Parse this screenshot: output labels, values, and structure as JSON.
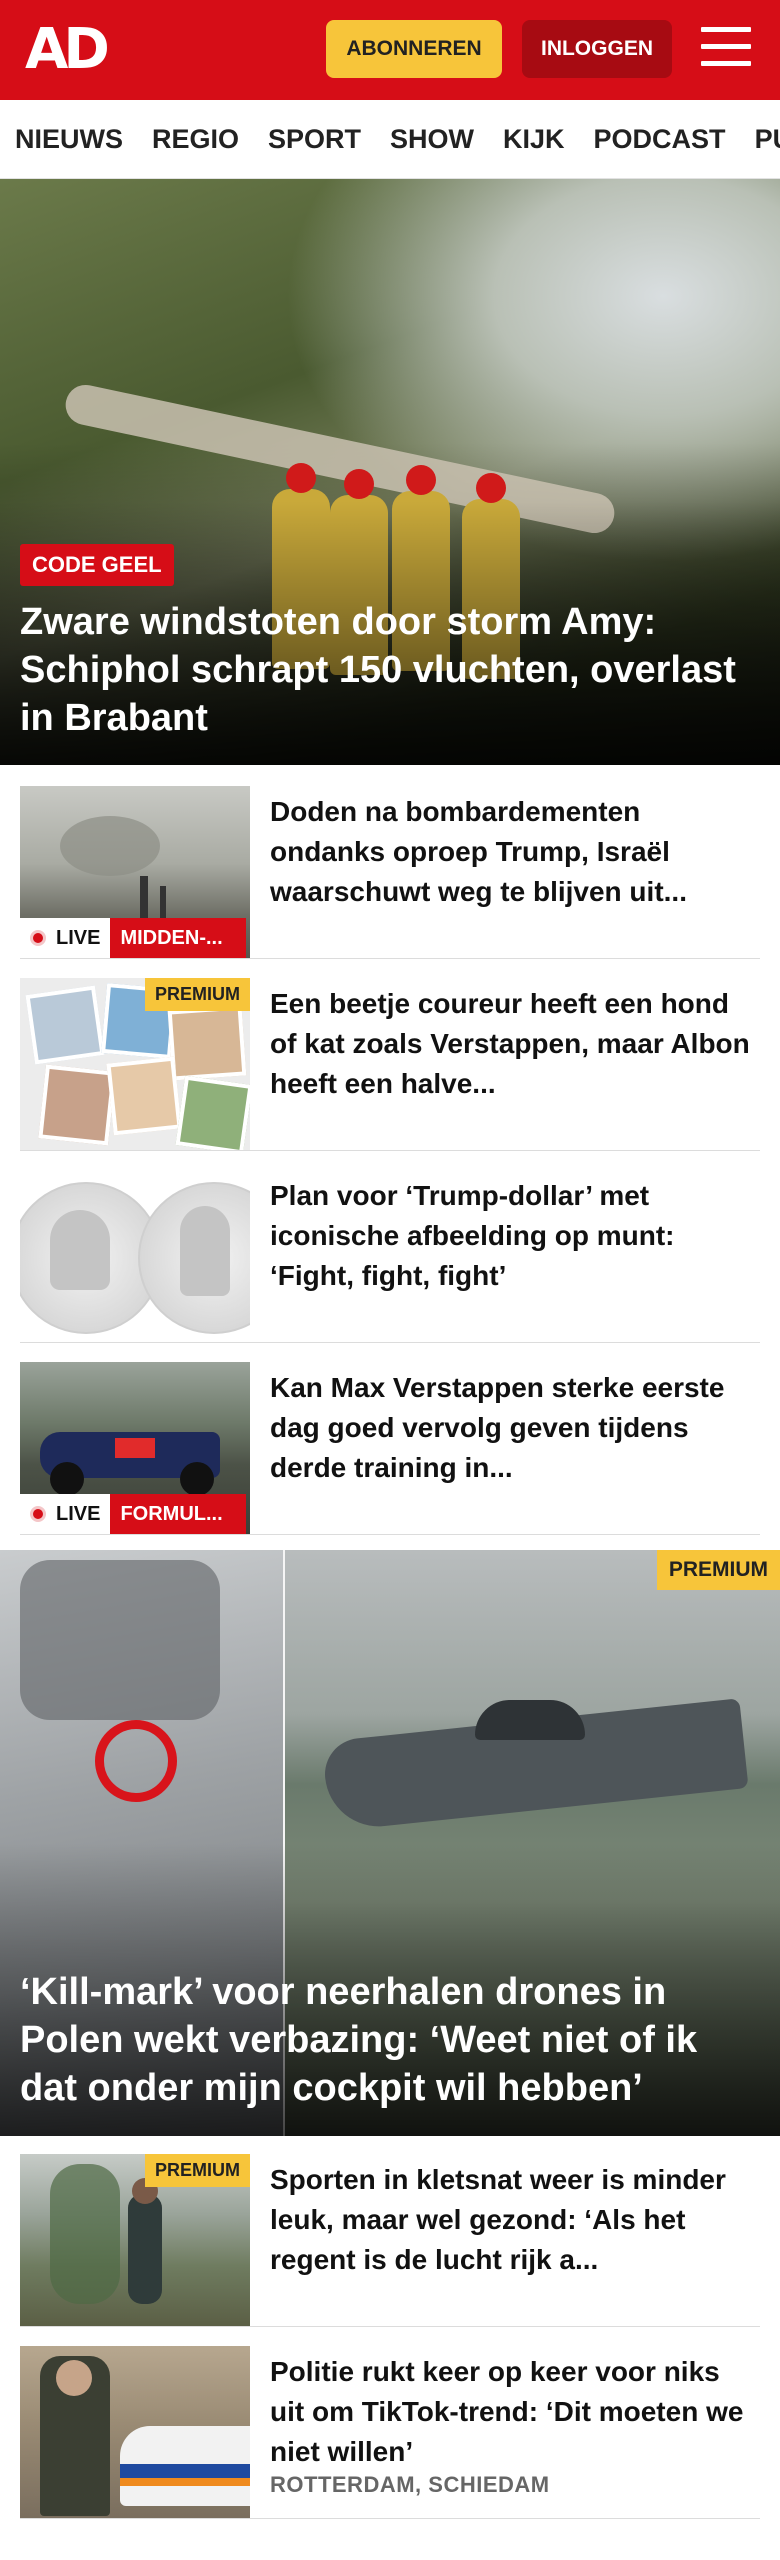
{
  "header": {
    "logo": "AD",
    "subscribe_label": "ABONNEREN",
    "login_label": "INLOGGEN",
    "menu_icon": "hamburger-menu-icon",
    "brand_color": "#d60d17",
    "subscribe_color": "#f7c53a"
  },
  "nav": {
    "items": [
      "NIEUWS",
      "REGIO",
      "SPORT",
      "SHOW",
      "KIJK",
      "PODCAST",
      "PUZZ"
    ]
  },
  "hero": {
    "tag": "CODE GEEL",
    "title": "Zware windstoten door storm Amy: Schiphol schrapt 150 vluchten, overlast in Brabant"
  },
  "articles": [
    {
      "title": "Doden na bombardementen ondanks oproep Trump, Israël waarschuwt weg te blijven uit...",
      "live_label": "LIVE",
      "live_category": "MIDDEN-..."
    },
    {
      "title": "Een beetje coureur heeft een hond of kat zoals Verstappen, maar Albon heeft een halve...",
      "badge": "PREMIUM"
    },
    {
      "title": "Plan voor ‘Trump-dollar’ met iconische afbeelding op munt: ‘Fight, fight, fight’"
    },
    {
      "title": "Kan Max Verstappen sterke eerste dag goed vervolg geven tijdens derde training in...",
      "live_label": "LIVE",
      "live_category": "FORMUL..."
    }
  ],
  "hero2": {
    "badge": "PREMIUM",
    "title": "‘Kill-mark’ voor neerhalen drones in Polen wekt verbazing: ‘Weet niet of ik dat onder mijn cockpit wil hebben’"
  },
  "articles2": [
    {
      "title": "Sporten in kletsnat weer is minder leuk, maar wel gezond: ‘Als het regent is de lucht rijk a...",
      "badge": "PREMIUM"
    },
    {
      "title": "Politie rukt keer op keer voor niks uit om TikTok-trend: ‘Dit moeten we niet willen’",
      "locality": "ROTTERDAM, SCHIEDAM"
    }
  ]
}
